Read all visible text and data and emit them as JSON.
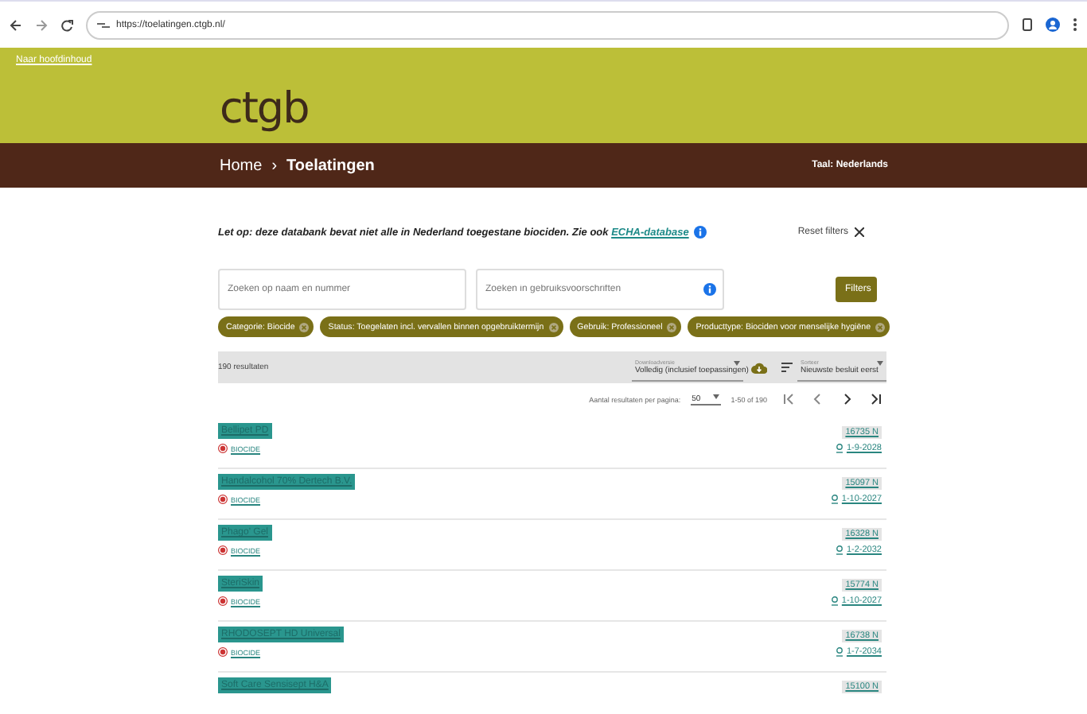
{
  "browser": {
    "url": "https://toelatingen.ctgb.nl/"
  },
  "header": {
    "skip_link": "Naar hoofdinhoud",
    "logo": "ctgb",
    "breadcrumb": [
      "Home",
      "›",
      "Toelatingen"
    ],
    "language": "Taal: Nederlands"
  },
  "notice": {
    "text": "Let op: deze databank bevat niet alle in Nederland toegestane biociden. Zie ook",
    "link": "ECHA-database"
  },
  "reset_filters": "Reset filters",
  "search": [
    {
      "placeholder": "Zoeken op naam en nummer",
      "info": false
    },
    {
      "placeholder": "Zoeken in gebruiksvoorschriften",
      "info": true
    }
  ],
  "filters_button": "Filters",
  "chips": [
    "Categorie: Biocide",
    "Status: Toegelaten incl. vervallen binnen opgebruiktermijn",
    "Gebruik: Professioneel",
    "Producttype: Biociden voor menselijke hygiëne"
  ],
  "results_bar": {
    "count": "190 resultaten",
    "download": {
      "label": "Downloadversie",
      "value": "Volledig (inclusief toepassingen)"
    },
    "sort": {
      "label": "Sorteer",
      "value": "Nieuwste besluit eerst"
    }
  },
  "pagination": {
    "per_page_label": "Aantal resultaten per pagina:",
    "per_page": "50",
    "range": "1-50 of 190"
  },
  "results": [
    {
      "name": "Bellipet PD",
      "category": "BIOCIDE",
      "number": "16735 N",
      "date": "1-9-2028"
    },
    {
      "name": "Handalcohol 70% Dertech B.V.",
      "category": "BIOCIDE",
      "number": "15097 N",
      "date": "1-10-2027"
    },
    {
      "name": "Phago' Gel",
      "category": "BIOCIDE",
      "number": "16328 N",
      "date": "1-2-2032"
    },
    {
      "name": "SteriSkin",
      "category": "BIOCIDE",
      "number": "15774 N",
      "date": "1-10-2027"
    },
    {
      "name": "RHODOSEPT HD Universal",
      "category": "BIOCIDE",
      "number": "16738 N",
      "date": "1-7-2034"
    },
    {
      "name": "Soft Care Sensisept H&A",
      "number": "15100 N"
    }
  ]
}
